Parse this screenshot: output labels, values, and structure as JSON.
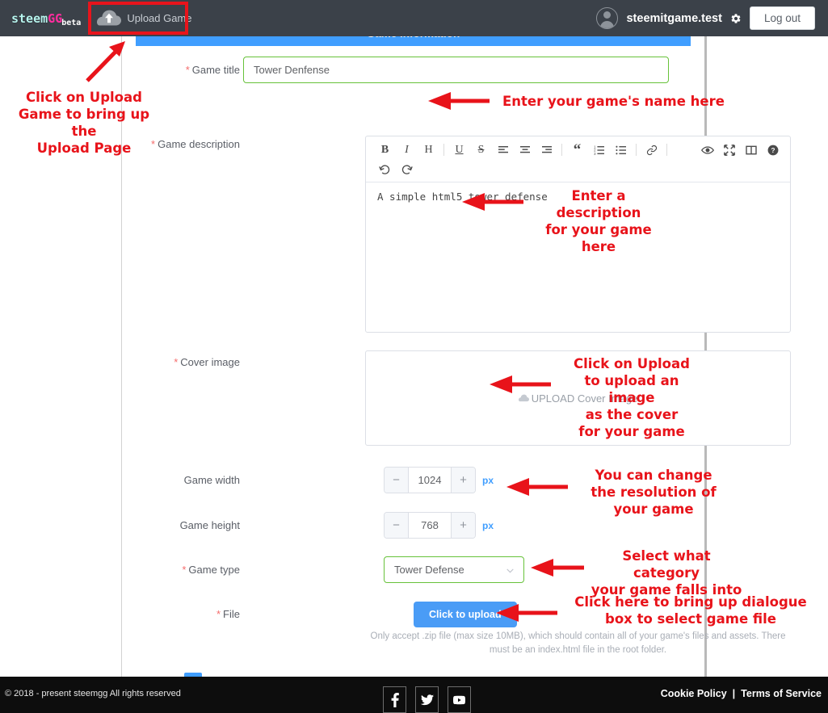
{
  "nav": {
    "logo": {
      "part1": "steem",
      "part2": "GG",
      "part3": "beta"
    },
    "upload_game_label": "Upload Game",
    "username": "steemitgame.test",
    "logout_label": "Log out",
    "icons": {
      "cloud": "cloud-upload-icon",
      "gear": "gear-icon",
      "avatar": "avatar-icon"
    }
  },
  "form": {
    "section_title": "Game information",
    "game_title": {
      "label": "Game title",
      "value": "Tower Denfense",
      "required": true
    },
    "game_description": {
      "label": "Game description",
      "value": "A simple html5 tower defense",
      "required": true,
      "toolbar": [
        "B",
        "I",
        "H",
        "U",
        "S",
        "align-left",
        "align-center",
        "align-right",
        "quote",
        "ordered-list",
        "unordered-list",
        "link",
        "preview",
        "fullscreen",
        "split-view",
        "help",
        "undo",
        "redo"
      ]
    },
    "cover_image": {
      "label": "Cover image",
      "placeholder": "UPLOAD Cover Image",
      "required": true
    },
    "game_width": {
      "label": "Game width",
      "value": "1024",
      "unit": "px",
      "minus": "−",
      "plus": "+"
    },
    "game_height": {
      "label": "Game height",
      "value": "768",
      "unit": "px",
      "minus": "−",
      "plus": "+"
    },
    "game_type": {
      "label": "Game type",
      "value": "Tower Defense",
      "required": true
    },
    "file": {
      "label": "File",
      "button_label": "Click to upload",
      "required": true
    },
    "help_text": "Only accept .zip file (max size 10MB), which should contain all of your game's files and assets. There must be an index.html file in the root folder.",
    "required_marker": "*"
  },
  "annotations": {
    "upload_game": "Click on Upload\nGame to bring up the\nUpload Page",
    "game_name": "Enter your game's name here",
    "description": "Enter a description\nfor your game here",
    "cover": "Click on Upload\nto upload an image\nas the cover\nfor your game",
    "resolution": "You can change\nthe resolution of\nyour game",
    "game_type": "Select what category\nyour game falls into",
    "file": "Click here to bring up dialogue\nbox to select game file"
  },
  "footer": {
    "copyright": "© 2018 - present steemgg All rights reserved",
    "social": [
      "facebook-icon",
      "twitter-icon",
      "youtube-icon"
    ],
    "cookie_policy": "Cookie Policy",
    "separator": "|",
    "terms": "Terms of Service"
  },
  "colors": {
    "nav_bg": "#3b4149",
    "accent_blue": "#409eff",
    "valid_green": "#67c23a",
    "annotation_red": "#e8131a",
    "footer_bg": "#0d0d0d"
  }
}
